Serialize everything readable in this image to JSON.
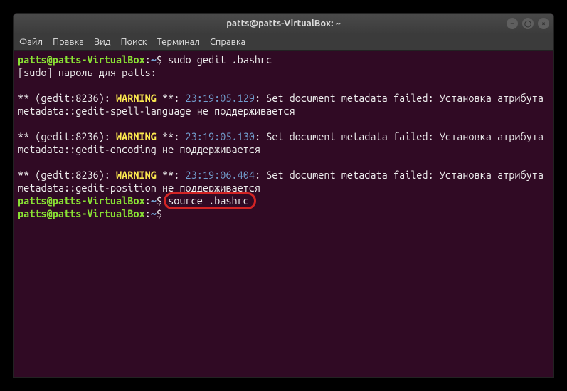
{
  "titlebar": {
    "title": "patts@patts-VirtualBox: ~"
  },
  "menu": {
    "file": "Файл",
    "edit": "Правка",
    "view": "Вид",
    "search": "Поиск",
    "terminal": "Терминал",
    "help": "Справка"
  },
  "prompt": {
    "user_host": "patts@patts-VirtualBox",
    "sep": ":",
    "path": "~",
    "sign": "$"
  },
  "lines": {
    "cmd1": " sudo gedit .bashrc",
    "sudo_pw": "[sudo] пароль для patts:",
    "star": "** (gedit:8236): ",
    "warn": "WARNING",
    "warn_after": " **: ",
    "ts1": "23:19:05.129",
    "ts2": "23:19:05.130",
    "ts3": "23:19:06.404",
    "msg_prefix": ": Set document metadata failed: Установка атрибута metadata::",
    "attr1": "gedit-spell-language",
    "attr2": "gedit-encoding",
    "attr3": "gedit-position",
    "msg_suffix": " не поддерживается",
    "cmd2": "source .bashrc"
  }
}
